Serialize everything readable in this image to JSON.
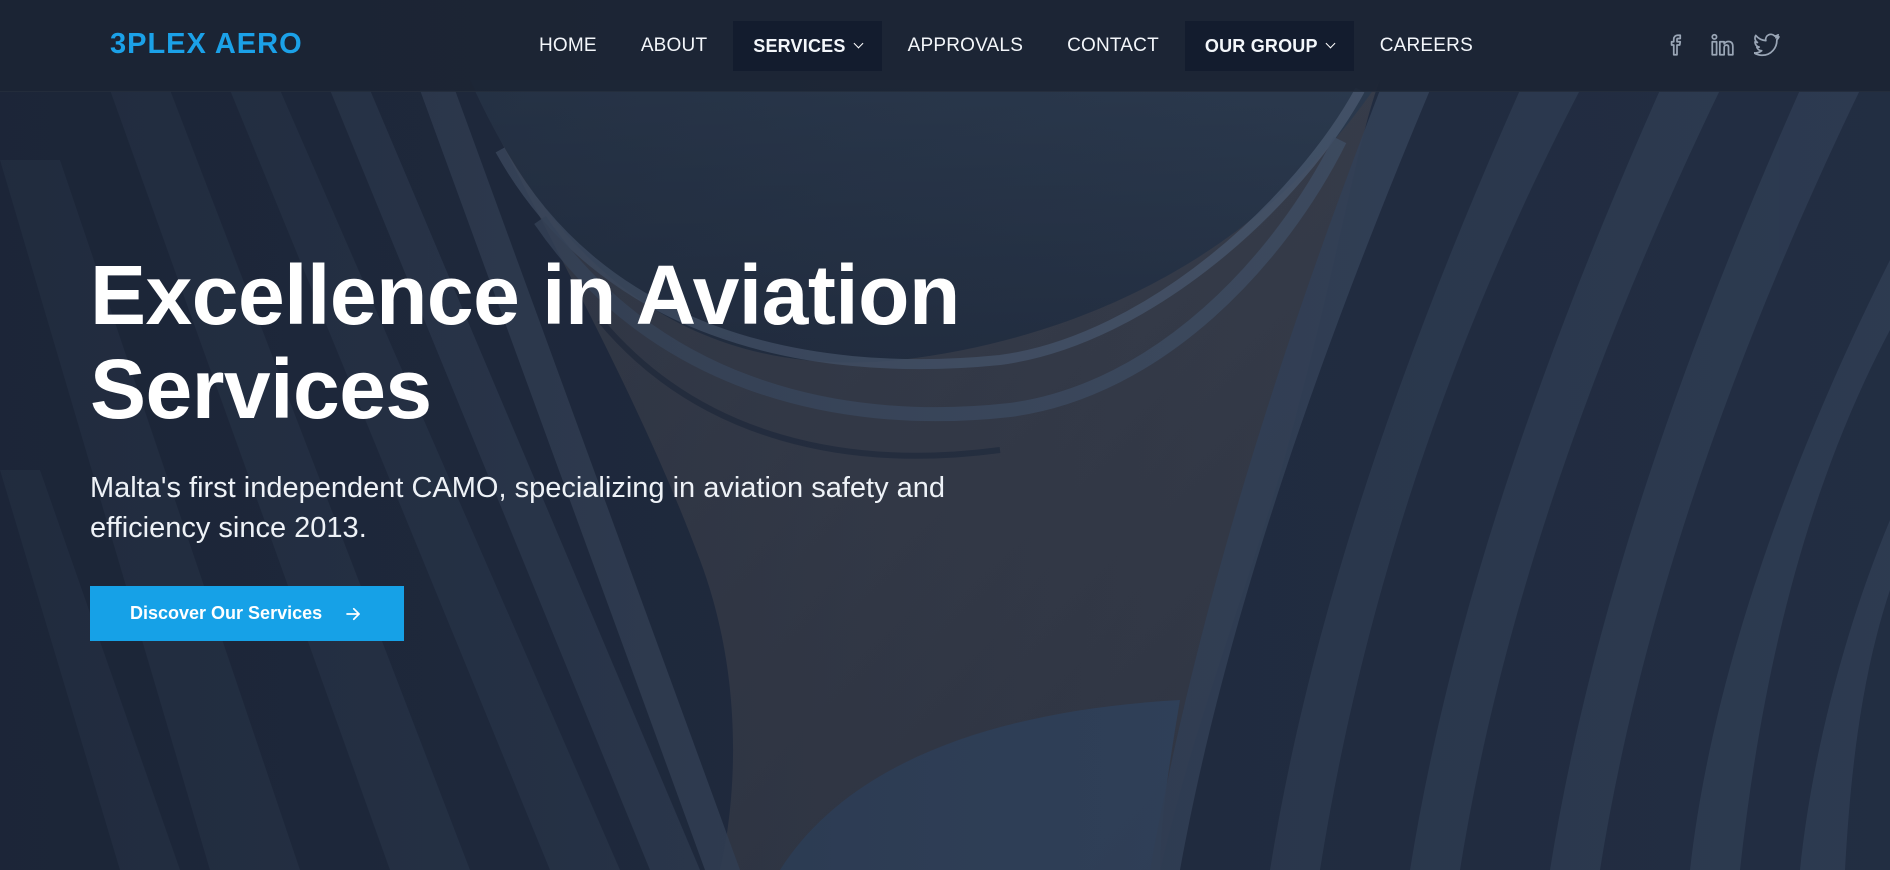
{
  "brand": {
    "logo_text": "3PLEX AERO",
    "accent_color": "#1ba1e8"
  },
  "nav": {
    "items": [
      {
        "label": "HOME",
        "dropdown": false
      },
      {
        "label": "ABOUT",
        "dropdown": false
      },
      {
        "label": "SERVICES",
        "dropdown": true
      },
      {
        "label": "APPROVALS",
        "dropdown": false
      },
      {
        "label": "CONTACT",
        "dropdown": false
      },
      {
        "label": "OUR GROUP",
        "dropdown": true
      },
      {
        "label": "CAREERS",
        "dropdown": false
      }
    ]
  },
  "social": {
    "icons": [
      "facebook-icon",
      "linkedin-icon",
      "twitter-icon"
    ]
  },
  "hero": {
    "title_line1": "Excellence in Aviation",
    "title_line2": "Services",
    "subtitle": "Malta's first independent CAMO, specializing in aviation safety and efficiency since 2013.",
    "cta_label": "Discover Our Services",
    "cta_icon": "arrow-right-icon",
    "cta_color": "#16a1e7"
  }
}
